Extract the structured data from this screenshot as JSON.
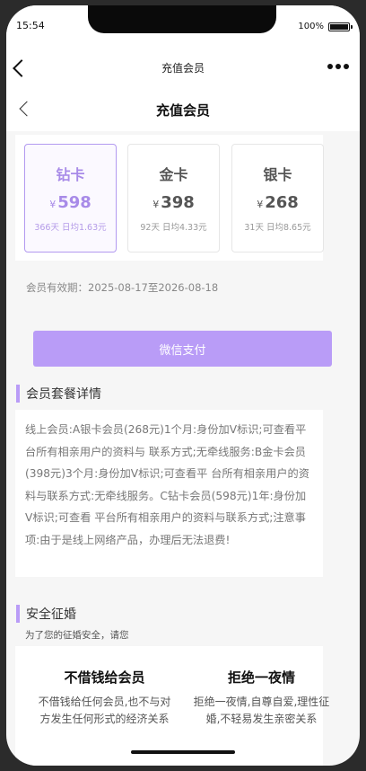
{
  "status_bar": {
    "time": "15:54",
    "battery_text": "100%"
  },
  "top_nav": {
    "title": "充值会员"
  },
  "page_header": {
    "title": "充值会员"
  },
  "plans": [
    {
      "name": "钻卡",
      "currency": "¥",
      "price": "598",
      "desc": "366天 日均1.63元",
      "selected": true
    },
    {
      "name": "金卡",
      "currency": "¥",
      "price": "398",
      "desc": "92天 日均4.33元",
      "selected": false
    },
    {
      "name": "银卡",
      "currency": "¥",
      "price": "268",
      "desc": "31天 日均8.65元",
      "selected": false
    }
  ],
  "validity": "会员有效期：2025-08-17至2026-08-18",
  "pay_button": {
    "label": "微信支付"
  },
  "details_section": {
    "title": "会员套餐详情",
    "content": "线上会员:A银卡会员(268元)1个月:身份加V标识;可查看平台所有相亲用户的资料与 联系方式;无牵线服务:B金卡会员(398元)3个月:身份加V标识;可查看平 台所有相亲用户的资料与联系方式:无牵线服务。C钻卡会员(598元)1年:身份加V标识;可查看 平台所有相亲用户的资料与联系方式;注意事项:由于是线上网络产品，办理后无法退费!"
  },
  "safety_section": {
    "title": "安全征婚",
    "subtitle": "为了您的征婚安全，请您",
    "items": [
      {
        "heading": "不借钱给会员",
        "text": "不借钱给任何会员,也不与对方发生任何形式的经济关系"
      },
      {
        "heading": "拒绝一夜情",
        "text": "拒绝一夜情,自尊自爱,理性征婚,不轻易发生亲密关系"
      }
    ]
  },
  "colors": {
    "accent": "#b99cf7",
    "selected_text": "#a88be8",
    "background": "#f6f6f6"
  }
}
